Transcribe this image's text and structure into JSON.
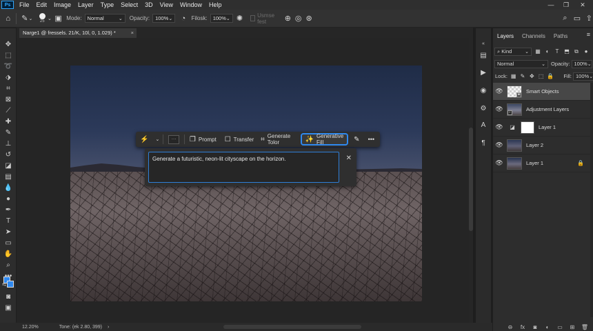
{
  "app": {
    "logo": "Ps"
  },
  "menu": [
    "File",
    "Edit",
    "Image",
    "Layer",
    "Type",
    "Select",
    "3D",
    "View",
    "Window",
    "Help"
  ],
  "options_bar": {
    "brush_size": "25",
    "mode_label": "Mode:",
    "mode_value": "Normal",
    "opacity_label": "Opacity:",
    "opacity_value": "100%",
    "flow_label": "Filosk:",
    "flow_value": "100%",
    "sample_label": "Usmse fest"
  },
  "document": {
    "tab_title": "Narge1 @ fressels. 21/K, 10l, 0, 1.029) *"
  },
  "context_bar": {
    "prompt": "Prompt",
    "transfer": "Transfer",
    "generate_tolor": "Generate Tolor",
    "generative_fill": "Generative Fill"
  },
  "prompt_box": {
    "value": "Generate a futuristic, neon-lit cityscape on the horizon."
  },
  "layers_panel": {
    "tabs": [
      "Layers",
      "Channels",
      "Paths"
    ],
    "kind_label": "Kind",
    "blend_mode": "Normal",
    "opacity_label": "Opacity:",
    "opacity_value": "100%",
    "lock_label": "Lock:",
    "fill_label": "Fill:",
    "fill_value": "100%",
    "layers": [
      {
        "name": "Smart Objects",
        "selected": true
      },
      {
        "name": "Adjustment Layers",
        "selected": false
      },
      {
        "name": "Layer 1",
        "selected": false
      },
      {
        "name": "Layer 2",
        "selected": false
      },
      {
        "name": "Layer 1",
        "selected": false,
        "locked": true
      }
    ]
  },
  "status_bar": {
    "zoom": "12.20%",
    "info": "Tone: (ek 2.80, 399)"
  },
  "colors": {
    "accent": "#2f89f0",
    "panel": "#2d2d2d",
    "canvas_bg": "#252525"
  }
}
